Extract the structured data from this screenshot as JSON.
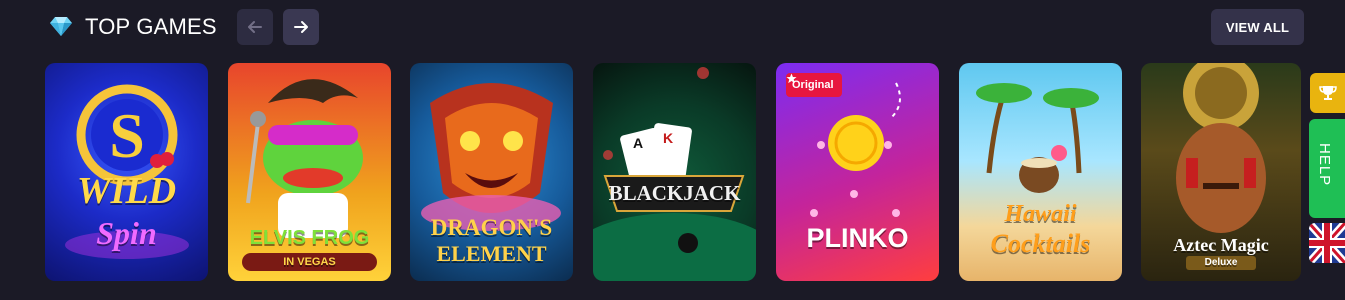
{
  "header": {
    "title": "TOP GAMES",
    "view_all_label": "VIEW ALL",
    "icon": "diamond-icon"
  },
  "nav": {
    "prev_icon": "arrow-left-icon",
    "next_icon": "arrow-right-icon"
  },
  "games": [
    {
      "name_line1": "WILD",
      "name_line2": "Spin",
      "badge": ""
    },
    {
      "name_line1": "ELVIS FROG",
      "name_line2": "IN VEGAS",
      "badge": ""
    },
    {
      "name_line1": "DRAGON'S",
      "name_line2": "ELEMENT",
      "badge": ""
    },
    {
      "name_line1": "BLACKJACK",
      "name_line2": "",
      "badge": ""
    },
    {
      "name_line1": "PLINKO",
      "name_line2": "",
      "badge": "Original"
    },
    {
      "name_line1": "Hawaii",
      "name_line2": "Cocktails",
      "badge": ""
    },
    {
      "name_line1": "Aztec Magic",
      "name_line2": "Deluxe",
      "badge": ""
    }
  ],
  "side": {
    "help_label": "HELP",
    "trophy_icon": "trophy-icon",
    "language_flag": "uk-flag-icon"
  },
  "colors": {
    "background": "#1b1a26",
    "button": "#34324a",
    "help_green": "#1fbf55",
    "trophy_gold": "#e9b40f",
    "badge_red": "#e7163f"
  }
}
